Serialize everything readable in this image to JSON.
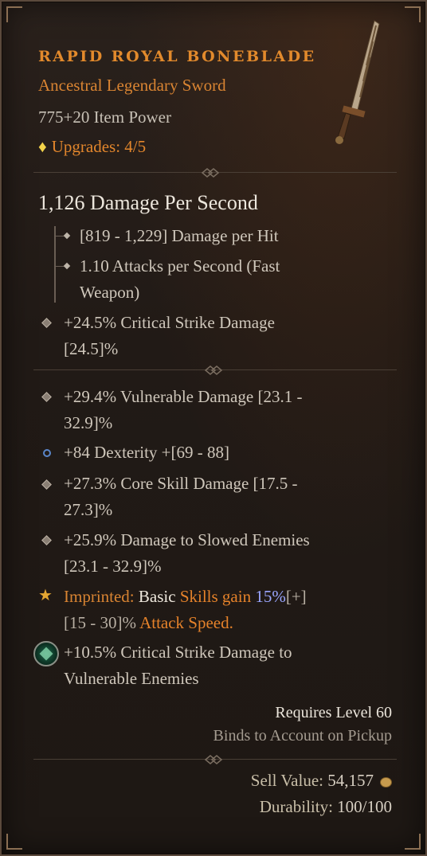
{
  "item": {
    "name": "RAPID ROYAL BONEBLADE",
    "subtitle": "Ancestral Legendary Sword",
    "item_power": "775+20 Item Power",
    "upgrades": "Upgrades: 4/5"
  },
  "weapon": {
    "dps": "1,126 Damage Per Second",
    "damage_per_hit": "[819 - 1,229] Damage per Hit",
    "attacks_line1": "1.10 Attacks per Second (Fast",
    "attacks_line2": "Weapon)",
    "implicit_line1": "+24.5% Critical Strike Damage",
    "implicit_line2": "[24.5]%"
  },
  "affixes": [
    {
      "line1": "+29.4% Vulnerable Damage [23.1 -",
      "line2": "32.9]%"
    },
    {
      "line1": "+84 Dexterity +[69 - 88]"
    },
    {
      "line1": "+27.3% Core Skill Damage [17.5 -",
      "line2": "27.3]%"
    },
    {
      "line1": "+25.9% Damage to Slowed Enemies",
      "line2": "[23.1 - 32.9]%"
    }
  ],
  "imprint": {
    "label": "Imprinted: ",
    "basic": "Basic ",
    "skills_gain": "Skills gain ",
    "value": "15%",
    "plus": "[+]",
    "range": "[15 - 30]% ",
    "attack_speed": "Attack Speed."
  },
  "socket": {
    "line1": "+10.5% Critical Strike Damage to",
    "line2": "Vulnerable Enemies"
  },
  "footer": {
    "requires": "Requires Level 60",
    "binds": "Binds to Account on Pickup",
    "sell_label": "Sell Value: ",
    "sell_value": "54,157",
    "durability_label": "Durability: ",
    "durability_value": "100/100"
  },
  "colors": {
    "legendary_orange": "#e28a2c",
    "imprint_blue": "#9aa6ff",
    "background": "#211a16"
  },
  "icons": [
    "upgrade-gem-icon",
    "sword-icon",
    "star-icon",
    "socket-gem-icon",
    "gold-coin-icon"
  ]
}
